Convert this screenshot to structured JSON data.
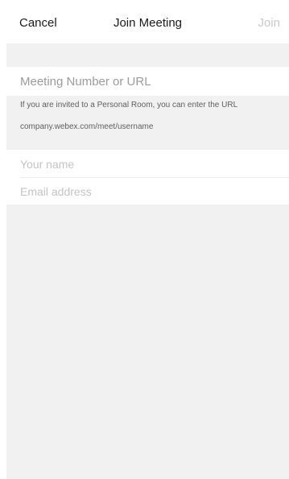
{
  "navbar": {
    "cancel_label": "Cancel",
    "title": "Join Meeting",
    "join_label": "Join"
  },
  "form": {
    "meeting_placeholder": "Meeting Number or URL",
    "hint_line_1": "If you are invited to a Personal Room, you can enter the URL",
    "hint_line_2": "company.webex.com/meet/username",
    "name_placeholder": "Your name",
    "email_placeholder": "Email address"
  },
  "colors": {
    "background": "#ffffff",
    "section_gray": "#f1f1f1",
    "disabled_text": "#c9c9c9"
  }
}
